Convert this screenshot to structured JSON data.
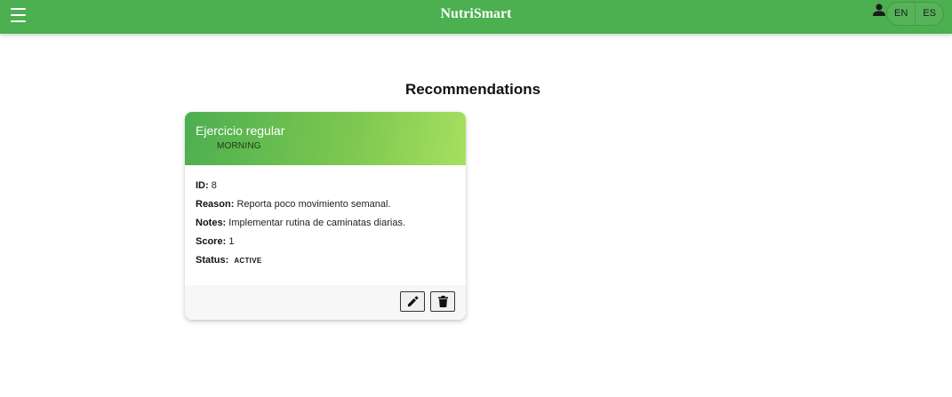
{
  "header": {
    "app_title": "NutriSmart",
    "menu_icon": "hamburger-menu-icon",
    "user_icon": "user-icon",
    "languages": [
      "EN",
      "ES"
    ],
    "accent_color": "#4caf50"
  },
  "main": {
    "page_title": "Recommendations"
  },
  "recommendation": {
    "title": "Ejercicio regular",
    "timing": "MORNING",
    "fields": {
      "id_label": "ID:",
      "id_value": "8",
      "reason_label": "Reason:",
      "reason_value": "Reporta poco movimiento semanal.",
      "notes_label": "Notes:",
      "notes_value": "Implementar rutina de caminatas diarias.",
      "score_label": "Score:",
      "score_value": "1",
      "status_label": "Status:",
      "status_value": "ACTIVE"
    },
    "actions": {
      "edit_icon": "pencil-icon",
      "delete_icon": "trash-icon"
    }
  }
}
